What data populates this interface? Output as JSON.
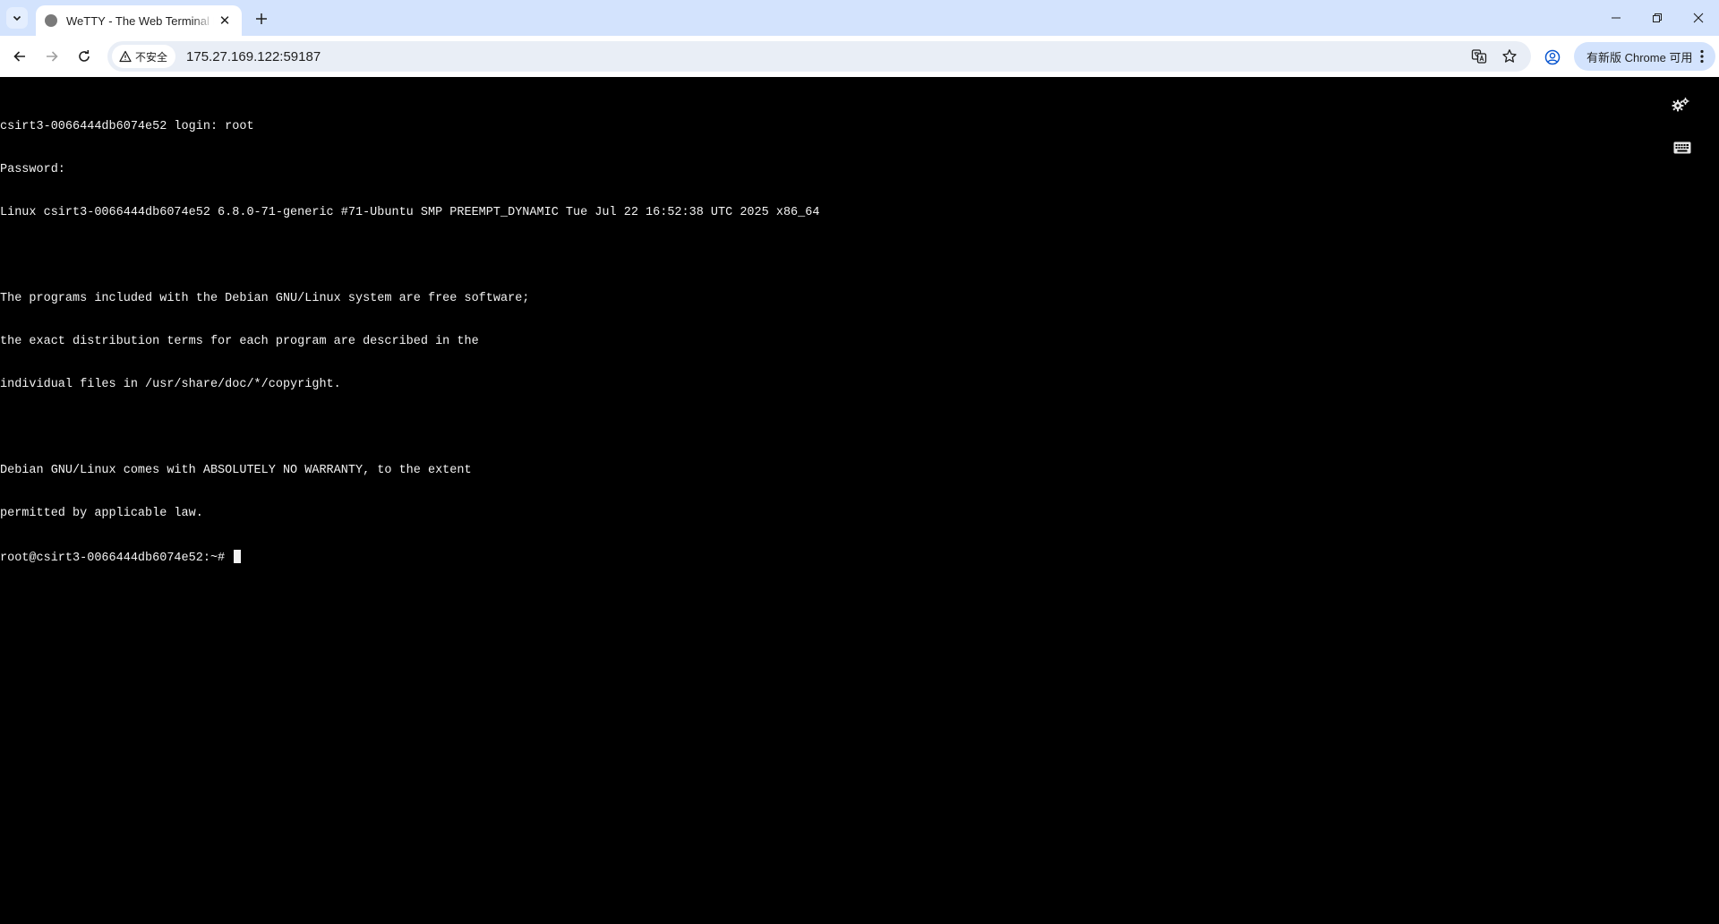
{
  "browser": {
    "tab": {
      "title": "WeTTY - The Web Terminal Emulator"
    },
    "address": {
      "security_label": "不安全",
      "url": "175.27.169.122:59187"
    },
    "update_button": "有新版 Chrome 可用"
  },
  "icons": {
    "tab_search": "chevron-down-icon",
    "new_tab": "plus-icon",
    "back": "arrow-left-icon",
    "forward": "arrow-right-icon",
    "reload": "reload-icon",
    "warning": "warning-triangle-icon",
    "translate": "translate-icon",
    "bookmark": "star-icon",
    "profile": "profile-icon",
    "settings": "gears-icon",
    "keyboard": "keyboard-icon"
  },
  "terminal": {
    "lines": [
      "csirt3-0066444db6074e52 login: root",
      "Password:",
      "Linux csirt3-0066444db6074e52 6.8.0-71-generic #71-Ubuntu SMP PREEMPT_DYNAMIC Tue Jul 22 16:52:38 UTC 2025 x86_64",
      "",
      "The programs included with the Debian GNU/Linux system are free software;",
      "the exact distribution terms for each program are described in the",
      "individual files in /usr/share/doc/*/copyright.",
      "",
      "Debian GNU/Linux comes with ABSOLUTELY NO WARRANTY, to the extent",
      "permitted by applicable law."
    ],
    "prompt": "root@csirt3-0066444db6074e52:~# "
  }
}
